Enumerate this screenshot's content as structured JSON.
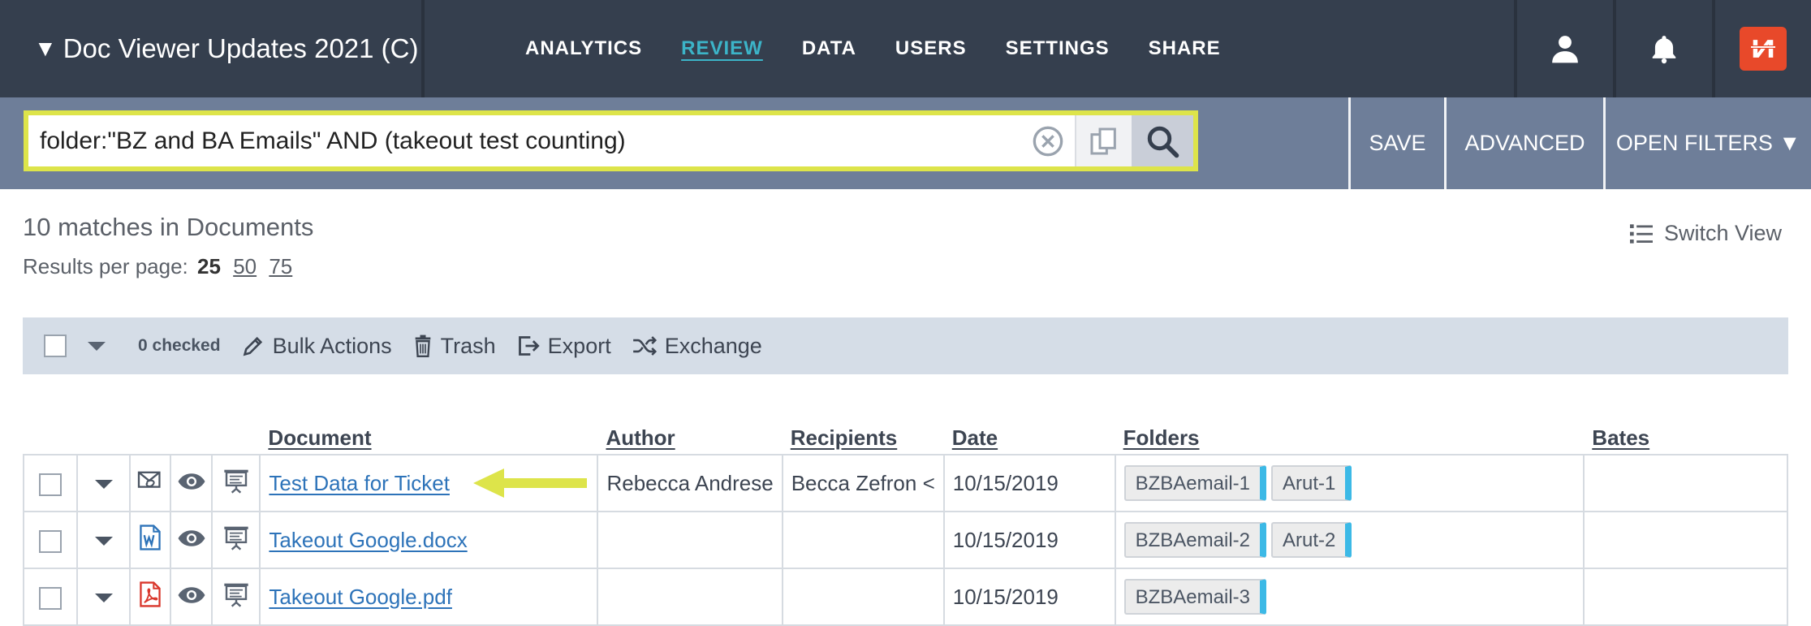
{
  "topbar": {
    "project_title": "Doc Viewer Updates 2021 (C)",
    "project_caret": "▼",
    "nav": [
      {
        "label": "ANALYTICS",
        "active": false
      },
      {
        "label": "REVIEW",
        "active": true
      },
      {
        "label": "DATA",
        "active": false
      },
      {
        "label": "USERS",
        "active": false
      },
      {
        "label": "SETTINGS",
        "active": false
      },
      {
        "label": "SHARE",
        "active": false
      }
    ],
    "icons": [
      "user-icon",
      "bell-icon",
      "logo-icon"
    ]
  },
  "search": {
    "query": "folder:\"BZ and BA Emails\" AND (takeout test counting)",
    "actions": {
      "save": "SAVE",
      "advanced": "ADVANCED",
      "open_filters": "OPEN FILTERS ▼"
    }
  },
  "results": {
    "matches_text": "10 matches in Documents",
    "per_page_label": "Results per page:",
    "per_page_options": [
      "25",
      "50",
      "75"
    ],
    "per_page_selected": "25",
    "switch_view": "Switch View"
  },
  "toolbar": {
    "checked_count": "0 checked",
    "bulk_actions": "Bulk Actions",
    "trash": "Trash",
    "export": "Export",
    "exchange": "Exchange"
  },
  "table": {
    "columns": [
      "Document",
      "Author",
      "Recipients",
      "Date",
      "Folders",
      "Bates"
    ],
    "rows": [
      {
        "type_icon": "email-attachment-icon",
        "document": "Test Data for Ticket",
        "author": "Rebecca Andrese",
        "recipients": "Becca Zefron <",
        "date": "10/15/2019",
        "folders": [
          "BZBAemail-1",
          "Arut-1"
        ],
        "bates": ""
      },
      {
        "type_icon": "word-doc-icon",
        "document": "Takeout Google.docx",
        "author": "",
        "recipients": "",
        "date": "10/15/2019",
        "folders": [
          "BZBAemail-2",
          "Arut-2"
        ],
        "bates": ""
      },
      {
        "type_icon": "pdf-icon",
        "document": "Takeout Google.pdf",
        "author": "",
        "recipients": "",
        "date": "10/15/2019",
        "folders": [
          "BZBAemail-3"
        ],
        "bates": ""
      }
    ]
  },
  "colors": {
    "topbar": "#353f4e",
    "searchbar": "#6e7e99",
    "search_highlight": "#dde44a",
    "active_nav": "#3cb4c8",
    "link": "#2d73b9",
    "folder_tag_accent": "#3cb9e6",
    "annotation_arrow": "#dde44a"
  }
}
